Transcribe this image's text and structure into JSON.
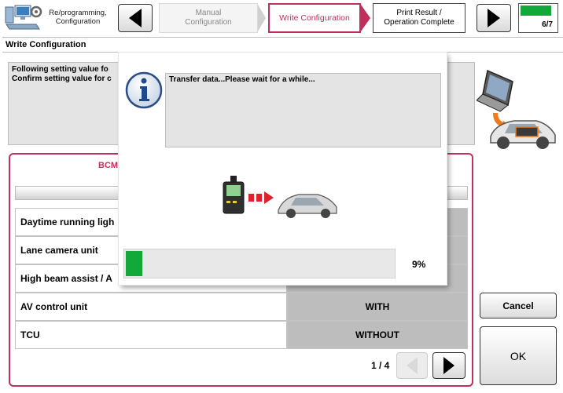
{
  "steps": {
    "step1_label": "Re/programming,\nConfiguration",
    "step2_label": "Manual\nConfiguration",
    "step3_label": "Write Configuration",
    "step4_label": "Print Result /\nOperation Complete",
    "progress_label": "6/7",
    "progress_fraction": 0.857
  },
  "page_title": "Write Configuration",
  "instructions": {
    "line1": "Following setting value fo",
    "line2": "Confirm setting value for c"
  },
  "bcm": {
    "tab_label": "BCM",
    "rows": [
      {
        "name": "Daytime running ligh",
        "value": ""
      },
      {
        "name": "Lane camera unit",
        "value": ""
      },
      {
        "name": "High beam assist / A",
        "value": ""
      },
      {
        "name": "AV control unit",
        "value": "WITH"
      },
      {
        "name": "TCU",
        "value": "WITHOUT"
      }
    ],
    "page_indicator": "1 / 4"
  },
  "buttons": {
    "cancel": "Cancel",
    "ok": "OK"
  },
  "dialog": {
    "message": "Transfer data...Please wait for a while...",
    "progress_percent_label": "9%",
    "progress_fraction": 0.09
  },
  "colors": {
    "accent": "#c0305a",
    "progress_green": "#12a83a",
    "panel_gray": "#e4e4e4"
  },
  "icons": {
    "step": "pc-gear-icon",
    "info": "info-icon",
    "vehicle": "laptop-car-icon",
    "transfer": "vi-to-car-icon"
  }
}
